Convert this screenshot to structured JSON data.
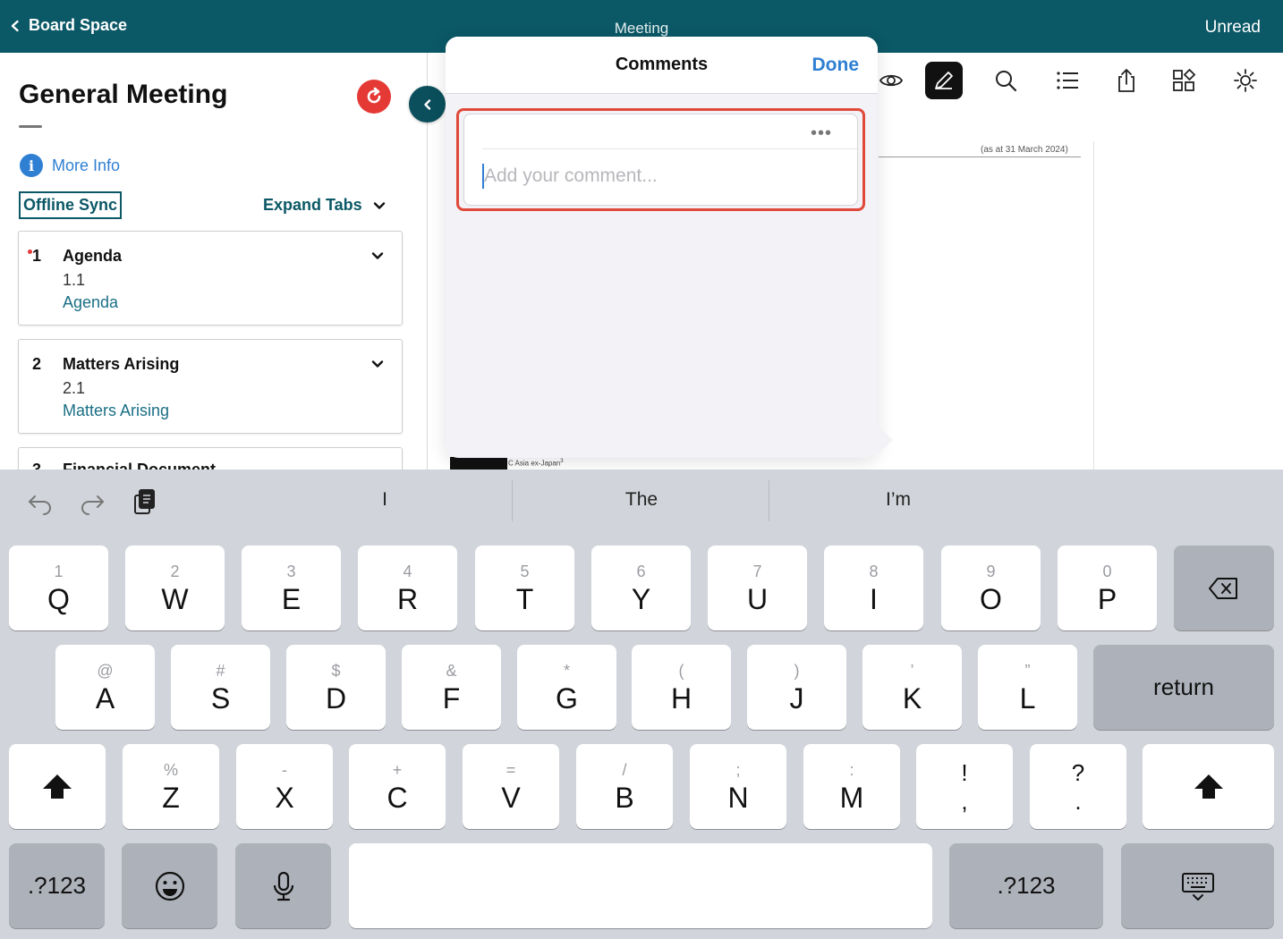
{
  "topbar": {
    "back_label": "Board Space",
    "center_title": "Meeting",
    "right_label": "Unread"
  },
  "sidebar": {
    "title": "General Meeting",
    "more_info": "More Info",
    "offline_sync": "Offline Sync",
    "expand_tabs": "Expand Tabs",
    "items": [
      {
        "number": "1",
        "title": "Agenda",
        "sub_number": "1.1",
        "link": "Agenda",
        "unread": true
      },
      {
        "number": "2",
        "title": "Matters Arising",
        "sub_number": "2.1",
        "link": "Matters Arising",
        "unread": false
      },
      {
        "number": "3",
        "title": "Financial Document",
        "unread": false
      }
    ]
  },
  "document": {
    "note": "(as at 31 March 2024)",
    "small_text": "C Asia ex-Japan"
  },
  "comments": {
    "title": "Comments",
    "done_label": "Done",
    "placeholder": "Add your comment...",
    "value": ""
  },
  "keyboard": {
    "suggestions": [
      "I",
      "The",
      "I’m"
    ],
    "row1": [
      {
        "alt": "1",
        "main": "Q"
      },
      {
        "alt": "2",
        "main": "W"
      },
      {
        "alt": "3",
        "main": "E"
      },
      {
        "alt": "4",
        "main": "R"
      },
      {
        "alt": "5",
        "main": "T"
      },
      {
        "alt": "6",
        "main": "Y"
      },
      {
        "alt": "7",
        "main": "U"
      },
      {
        "alt": "8",
        "main": "I"
      },
      {
        "alt": "9",
        "main": "O"
      },
      {
        "alt": "0",
        "main": "P"
      }
    ],
    "row2": [
      {
        "alt": "@",
        "main": "A"
      },
      {
        "alt": "#",
        "main": "S"
      },
      {
        "alt": "$",
        "main": "D"
      },
      {
        "alt": "&",
        "main": "F"
      },
      {
        "alt": "*",
        "main": "G"
      },
      {
        "alt": "(",
        "main": "H"
      },
      {
        "alt": ")",
        "main": "J"
      },
      {
        "alt": "’",
        "main": "K"
      },
      {
        "alt": "”",
        "main": "L"
      }
    ],
    "row3": [
      {
        "alt": "%",
        "main": "Z"
      },
      {
        "alt": "-",
        "main": "X"
      },
      {
        "alt": "+",
        "main": "C"
      },
      {
        "alt": "=",
        "main": "V"
      },
      {
        "alt": "/",
        "main": "B"
      },
      {
        "alt": ";",
        "main": "N"
      },
      {
        "alt": ":",
        "main": "M"
      },
      {
        "alt": "!",
        "main": ","
      },
      {
        "alt": "?",
        "main": "."
      }
    ],
    "return_label": "return",
    "numbers_label": ".?123"
  },
  "colors": {
    "brand_teal": "#0b5866",
    "link_blue": "#2f7fd3",
    "alert_red": "#e53935"
  }
}
